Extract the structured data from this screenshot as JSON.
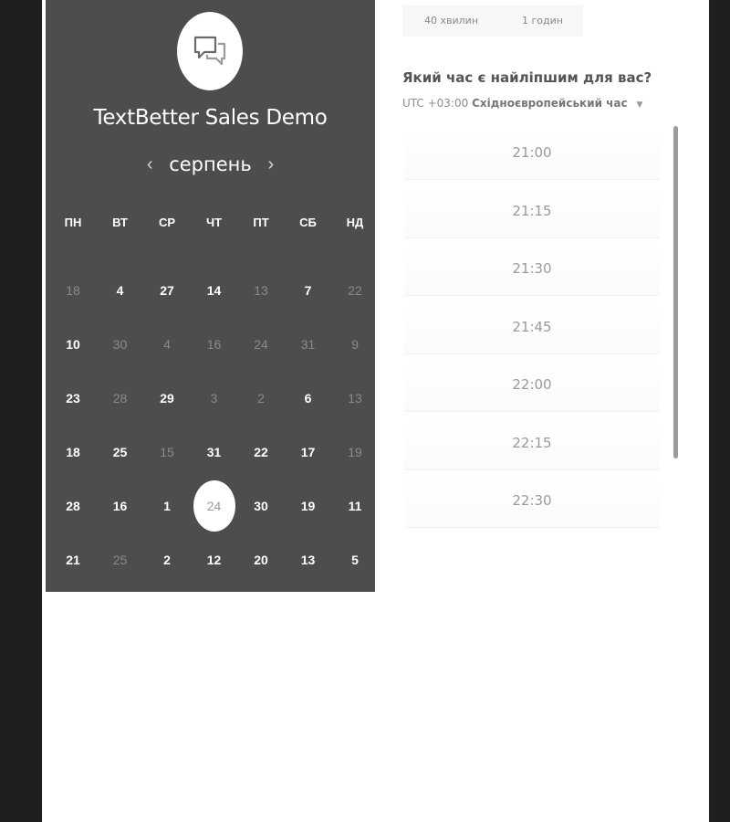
{
  "app": {
    "title": "TextBetter Sales Demo",
    "logo_icon": "chat-bubbles-icon"
  },
  "calendar": {
    "month": "серпень",
    "prev_icon": "chevron-left-icon",
    "next_icon": "chevron-right-icon",
    "weekdays": [
      "ПН",
      "ВТ",
      "СР",
      "ЧТ",
      "ПТ",
      "СБ",
      "НД"
    ],
    "rows": [
      [
        {
          "d": "18",
          "a": false
        },
        {
          "d": "4",
          "a": true
        },
        {
          "d": "27",
          "a": true
        },
        {
          "d": "14",
          "a": true
        },
        {
          "d": "13",
          "a": false
        },
        {
          "d": "7",
          "a": true
        },
        {
          "d": "22",
          "a": false
        }
      ],
      [
        {
          "d": "10",
          "a": true
        },
        {
          "d": "30",
          "a": false
        },
        {
          "d": "4",
          "a": false
        },
        {
          "d": "16",
          "a": false
        },
        {
          "d": "24",
          "a": false
        },
        {
          "d": "31",
          "a": false
        },
        {
          "d": "9",
          "a": false
        }
      ],
      [
        {
          "d": "23",
          "a": true
        },
        {
          "d": "28",
          "a": false
        },
        {
          "d": "29",
          "a": true
        },
        {
          "d": "3",
          "a": false
        },
        {
          "d": "2",
          "a": false
        },
        {
          "d": "6",
          "a": true
        },
        {
          "d": "13",
          "a": false
        }
      ],
      [
        {
          "d": "18",
          "a": true
        },
        {
          "d": "25",
          "a": true
        },
        {
          "d": "15",
          "a": false
        },
        {
          "d": "31",
          "a": true
        },
        {
          "d": "22",
          "a": true
        },
        {
          "d": "17",
          "a": true
        },
        {
          "d": "19",
          "a": false
        }
      ],
      [
        {
          "d": "28",
          "a": true
        },
        {
          "d": "16",
          "a": true
        },
        {
          "d": "1",
          "a": true
        },
        {
          "d": "24",
          "a": true,
          "selected": true
        },
        {
          "d": "30",
          "a": true
        },
        {
          "d": "19",
          "a": true
        },
        {
          "d": "11",
          "a": true
        }
      ],
      [
        {
          "d": "21",
          "a": true
        },
        {
          "d": "25",
          "a": false
        },
        {
          "d": "2",
          "a": true
        },
        {
          "d": "12",
          "a": true
        },
        {
          "d": "20",
          "a": true
        },
        {
          "d": "13",
          "a": true
        },
        {
          "d": "5",
          "a": true
        }
      ]
    ]
  },
  "duration": {
    "options": [
      "40 хвилин",
      "1 годин"
    ]
  },
  "time_picker": {
    "question": "Який час є найліпшим для вас?",
    "tz_offset": "UTC +03:00",
    "tz_name": "Східноєвропейський час",
    "slots": [
      "21:00",
      "21:15",
      "21:30",
      "21:45",
      "22:00",
      "22:15",
      "22:30"
    ]
  },
  "colors": {
    "calendar_bg": "#4d4d4d",
    "outer_bg": "#1f1f1f"
  }
}
